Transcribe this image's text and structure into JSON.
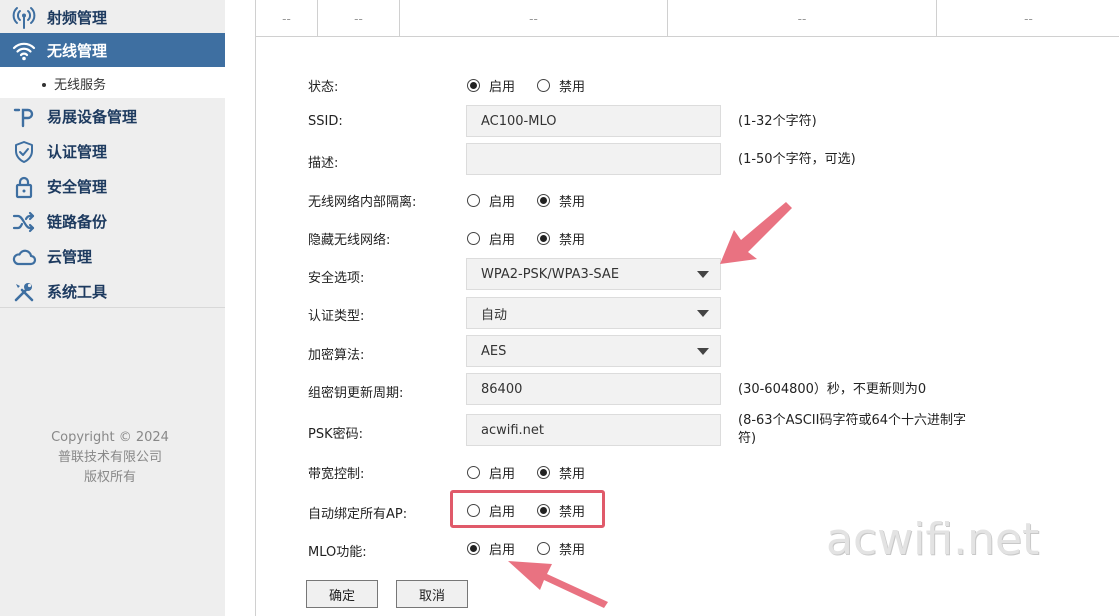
{
  "sidebar": {
    "items": [
      {
        "label": "射频管理",
        "icon": "wireless-tower-icon"
      },
      {
        "label": "无线管理",
        "icon": "wifi-icon",
        "active": true
      },
      {
        "label": "易展设备管理",
        "icon": "p-logo-icon"
      },
      {
        "label": "认证管理",
        "icon": "shield-check-icon"
      },
      {
        "label": "安全管理",
        "icon": "lock-icon"
      },
      {
        "label": "链路备份",
        "icon": "shuffle-icon"
      },
      {
        "label": "云管理",
        "icon": "cloud-icon"
      },
      {
        "label": "系统工具",
        "icon": "tools-icon"
      }
    ],
    "subitem": "无线服务",
    "copyright": [
      "Copyright © 2024",
      "普联技术有限公司",
      "版权所有"
    ]
  },
  "table": {
    "cells": [
      "--",
      "--",
      "--",
      "--",
      "--"
    ]
  },
  "form": {
    "status": {
      "label": "状态:",
      "options": [
        "启用",
        "禁用"
      ],
      "selected": 0
    },
    "ssid": {
      "label": "SSID:",
      "value": "AC100-MLO",
      "hint": "(1-32个字符)"
    },
    "desc": {
      "label": "描述:",
      "value": "",
      "hint": "(1-50个字符，可选)"
    },
    "isolation": {
      "label": "无线网络内部隔离:",
      "options": [
        "启用",
        "禁用"
      ],
      "selected": 1
    },
    "hidden": {
      "label": "隐藏无线网络:",
      "options": [
        "启用",
        "禁用"
      ],
      "selected": 1
    },
    "security": {
      "label": "安全选项:",
      "value": "WPA2-PSK/WPA3-SAE"
    },
    "auth_type": {
      "label": "认证类型:",
      "value": "自动"
    },
    "encryption": {
      "label": "加密算法:",
      "value": "AES"
    },
    "group_key": {
      "label": "组密钥更新周期:",
      "value": "86400",
      "hint": "(30-604800）秒，不更新则为0"
    },
    "psk": {
      "label": "PSK密码:",
      "value": "acwifi.net",
      "hint": [
        "(8-63个ASCII码字符或64个十六进制字",
        "符)"
      ]
    },
    "bandwidth": {
      "label": "带宽控制:",
      "options": [
        "启用",
        "禁用"
      ],
      "selected": 1
    },
    "auto_bind": {
      "label": "自动绑定所有AP:",
      "options": [
        "启用",
        "禁用"
      ],
      "selected": 1
    },
    "mlo": {
      "label": "MLO功能:",
      "options": [
        "启用",
        "禁用"
      ],
      "selected": 0
    },
    "ok_label": "确定",
    "cancel_label": "取消"
  },
  "watermark": "acwifi.net",
  "colors": {
    "sidebar_active": "#3e6fa1",
    "sidebar_text": "#1d3a5f",
    "annotation": "#e05a6a"
  }
}
